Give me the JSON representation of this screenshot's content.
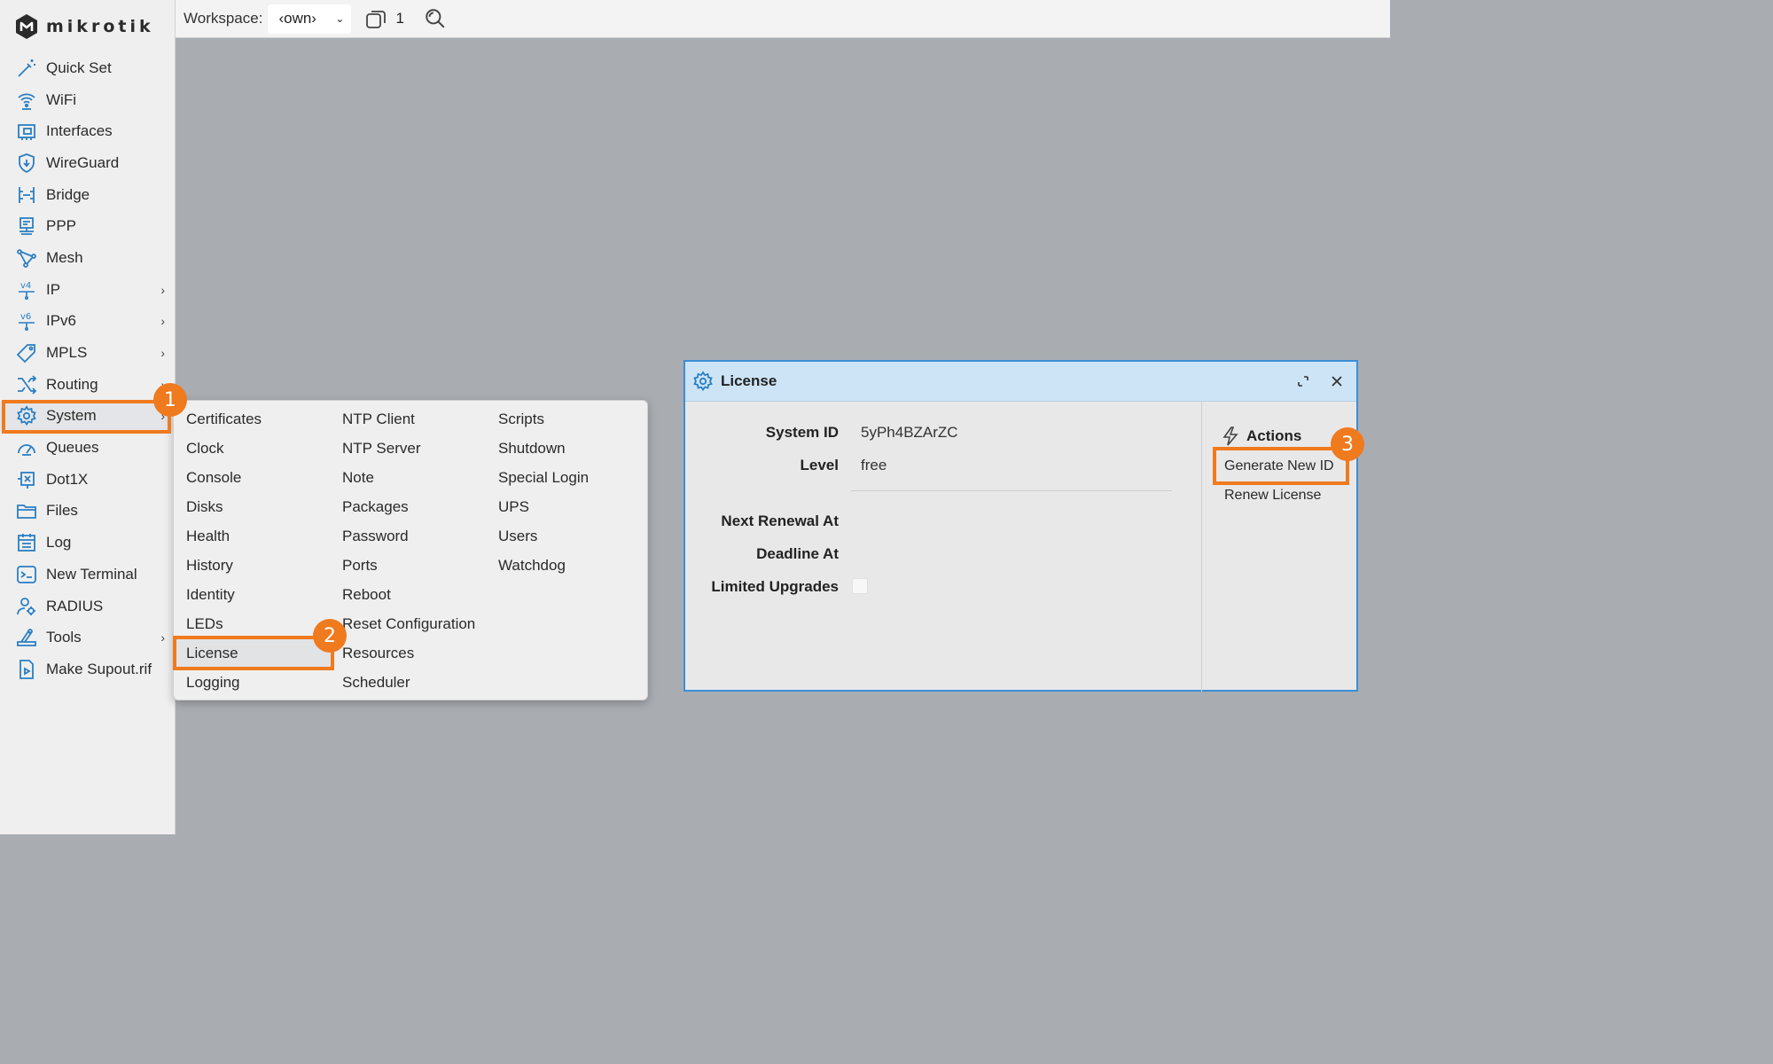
{
  "app": {
    "brand": "mikrotik"
  },
  "sidebar": {
    "items": [
      {
        "label": "Quick Set",
        "icon": "wand-icon"
      },
      {
        "label": "WiFi",
        "icon": "wifi-icon"
      },
      {
        "label": "Interfaces",
        "icon": "interfaces-icon"
      },
      {
        "label": "WireGuard",
        "icon": "wireguard-shield-icon"
      },
      {
        "label": "Bridge",
        "icon": "bridge-icon"
      },
      {
        "label": "PPP",
        "icon": "ppp-icon"
      },
      {
        "label": "Mesh",
        "icon": "mesh-icon"
      },
      {
        "label": "IP",
        "icon": "ipv4-icon",
        "submenu": true
      },
      {
        "label": "IPv6",
        "icon": "ipv6-icon",
        "submenu": true
      },
      {
        "label": "MPLS",
        "icon": "tag-icon",
        "submenu": true
      },
      {
        "label": "Routing",
        "icon": "routing-icon",
        "submenu": true
      },
      {
        "label": "System",
        "icon": "gear-icon",
        "submenu": true,
        "active": true
      },
      {
        "label": "Queues",
        "icon": "gauge-icon"
      },
      {
        "label": "Dot1X",
        "icon": "dot1x-icon"
      },
      {
        "label": "Files",
        "icon": "folder-icon"
      },
      {
        "label": "Log",
        "icon": "calendar-icon"
      },
      {
        "label": "New Terminal",
        "icon": "terminal-icon"
      },
      {
        "label": "RADIUS",
        "icon": "radius-users-icon"
      },
      {
        "label": "Tools",
        "icon": "tools-icon",
        "submenu": true
      },
      {
        "label": "Make Supout.rif",
        "icon": "supout-icon"
      }
    ]
  },
  "topbar": {
    "workspace_label": "Workspace:",
    "workspace_value": "‹own›",
    "window_count": "1"
  },
  "system_menu": {
    "col1": [
      "Certificates",
      "Clock",
      "Console",
      "Disks",
      "Health",
      "History",
      "Identity",
      "LEDs",
      "License",
      "Logging"
    ],
    "col2": [
      "NTP Client",
      "NTP Server",
      "Note",
      "Packages",
      "Password",
      "Ports",
      "Reboot",
      "Reset Configuration",
      "Resources",
      "Scheduler"
    ],
    "col3": [
      "Scripts",
      "Shutdown",
      "Special Login",
      "UPS",
      "Users",
      "Watchdog"
    ],
    "selected": "License"
  },
  "license_window": {
    "title": "License",
    "fields": {
      "system_id_label": "System ID",
      "system_id_value": "5yPh4BZArZC",
      "level_label": "Level",
      "level_value": "free",
      "next_renewal_label": "Next Renewal At",
      "deadline_label": "Deadline At",
      "limited_upgrades_label": "Limited Upgrades"
    },
    "actions": {
      "heading": "Actions",
      "generate_new_id": "Generate New ID",
      "renew_license": "Renew License"
    }
  },
  "annotations": {
    "step1": "1",
    "step2": "2",
    "step3": "3",
    "highlight_color": "#f07a1e"
  }
}
